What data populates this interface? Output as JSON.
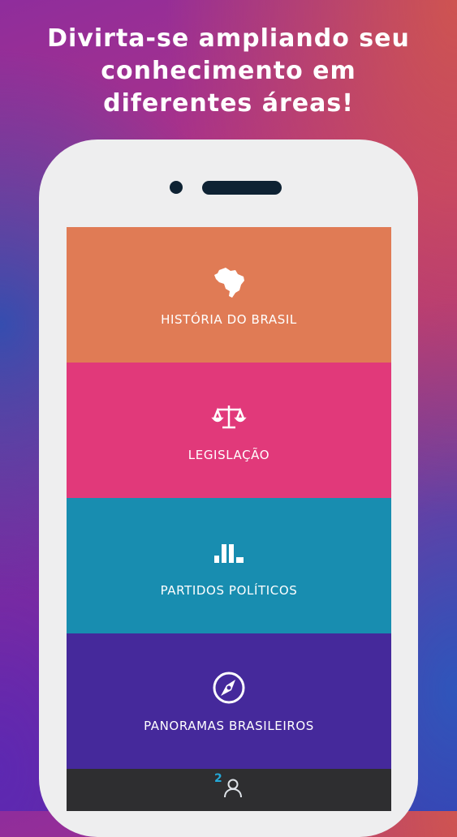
{
  "headline": {
    "line1": "Divirta-se ampliando seu",
    "line2": "conhecimento em",
    "line3": "diferentes áreas!"
  },
  "categories": [
    {
      "label": "HISTÓRIA DO BRASIL",
      "icon": "brazil-map-icon",
      "color": "#e07b55"
    },
    {
      "label": "LEGISLAÇÃO",
      "icon": "scales-of-justice-icon",
      "color": "#e1397a"
    },
    {
      "label": "PARTIDOS POLÍTICOS",
      "icon": "parties-icon",
      "color": "#188db0"
    },
    {
      "label": "PANORAMAS BRASILEIROS",
      "icon": "compass-icon",
      "color": "#45299b"
    }
  ],
  "bottom_bar": {
    "user_count": "2",
    "icon": "user-icon"
  }
}
